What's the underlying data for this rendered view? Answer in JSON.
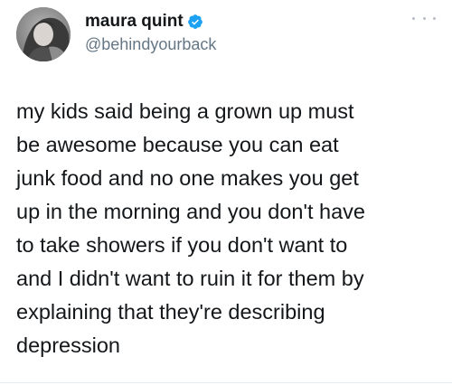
{
  "author": {
    "display_name": "maura quint",
    "handle": "@behindyourback",
    "verified": true,
    "avatar": "profile-photo"
  },
  "icons": {
    "verified": "verified-badge-icon",
    "more": "more-options-icon"
  },
  "colors": {
    "verified_blue": "#1da1f2",
    "handle_gray": "#657786",
    "text": "#14171a"
  },
  "tweet": {
    "text": "my kids said being a grown up must\nbe awesome because you can eat\njunk food and no one makes you get\nup in the morning and you don't have\nto take showers if you don't want to\nand I didn't want to ruin it for them by\nexplaining that they're describing\ndepression"
  }
}
